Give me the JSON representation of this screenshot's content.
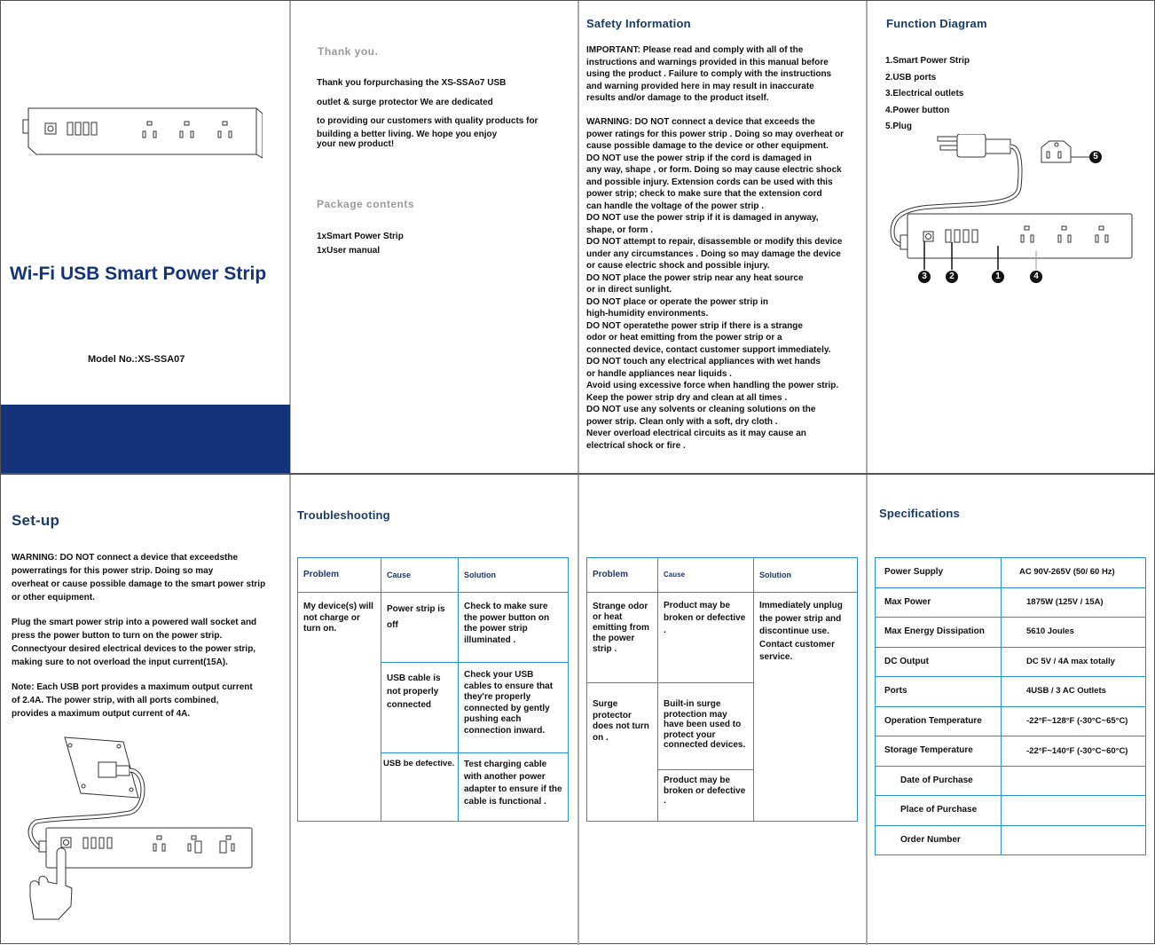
{
  "cover": {
    "title": "Wi-Fi USB Smart Power Strip",
    "model": "Model No.:XS-SSA07",
    "brand_color": "#15337a"
  },
  "thanks": {
    "heading": "Thank you.",
    "lines": [
      "Thank you forpurchasing  the XS-SSAo7 USB",
      "outlet & surge protector We are dedicated",
      "to providing our customers with quality products for",
      "building a better living. We hope you enjoy",
      "your new product!"
    ]
  },
  "package": {
    "heading": "Package contents",
    "items": [
      "1xSmart Power Strip",
      "1xUser manual"
    ]
  },
  "safety": {
    "heading": "Safety Information",
    "important": [
      "IMPORTANT: Please read and  comply with all of  the",
      "instructions and warnings provided  in this manual before",
      "using the product . Failure  to comply with the  instructions",
      "and warning provided here  in may result in  inaccurate",
      "results and/or damage to  the product itself."
    ],
    "warnings": [
      "WARNING: DO NOT  connect a device that  exceeds the",
      "power ratings for this  power strip . Doing so  may overheat or",
      "cause possible damage to  the device or other equipment.",
      "DO NOT use the power strip  if the cord is damaged in",
      "any way, shape , or form. Doing so may cause electric shock",
      "and possible injury.  Extension  cords can be used  with this",
      "power strip; check to make  sure that the extension  cord",
      "can handle the voltage of the power strip .",
      "DO NOT use the power strip  if it is damaged in anyway,",
      "shape, or form .",
      "DO NOT attempt to repair, disassemble or modify this  device",
      "under any circumstances . Doing  so may damage the  device",
      "or cause electric shock and possible injury.",
      "DO NOT place the power strip near any heat source",
      "or in direct sunlight.",
      "DO NOT place or operate the  power strip in",
      "high-humidity environments.",
      "DO NOT operatethe power strip  if there is a strange",
      "odor or heat emitting  from the power strip  or a",
      "connected device, contact customer  support immediately.",
      "DO NOT  touch any electrical appliances  with wet hands",
      "or handle appliances near  liquids .",
      "Avoid using excessive force  when handling the  power strip.",
      "Keep the power strip  dry and clean at  all times .",
      "DO NOT use any solvents or  cleaning solutions on the",
      "power strip. Clean only with a soft, dry cloth .",
      "Never overload electrical circuits as it may cause  an",
      "electrical shock or fire ."
    ]
  },
  "function": {
    "heading": "Function Diagram",
    "items": [
      "1.Smart Power Strip",
      "2.USB ports",
      "3.Electrical outlets",
      "4.Power button",
      "5.Plug"
    ],
    "callouts": [
      "1",
      "2",
      "3",
      "4",
      "5"
    ]
  },
  "setup": {
    "heading": "Set-up",
    "warning": [
      "WARNING:  DO NOT connect a device that exceedsthe",
      "powerratings for this power strip. Doing so may",
      "overheat or cause possible  damage to the smart  power strip",
      "or other equipment."
    ],
    "plug": [
      "Plug the smart power  strip into a powered  wall socket and",
      "press the power button to turn on the  power strip.",
      "Connectyour desired  electrical  devices to the power  strip,",
      "making sure to not overload the input current(15A)."
    ],
    "note": [
      "Note: Each USB port provides a maximum output current",
      "of 2.4A. The power strip, with all ports  combined,",
      "provides a maximum output current of 4A."
    ]
  },
  "troubleshooting": {
    "heading": "Troubleshooting",
    "headers": [
      "Problem",
      "Cause",
      "Solution"
    ],
    "table1": {
      "problem": "My device(s) will not charge or turn on.",
      "rows": [
        {
          "cause": "Power strip is off",
          "solution": "Check to make sure the power button on the power strip illuminated ."
        },
        {
          "cause": "USB cable is not properly connected",
          "solution": "Check your USB cables to ensure that they're properly connected by gently pushing each connection inward."
        },
        {
          "cause": "USB be defective.",
          "solution": "Test charging  cable with another power adapter to ensure if the cable is functional ."
        }
      ]
    },
    "table2": {
      "row1": {
        "problem": "Strange odor or heat emitting from the power strip .",
        "cause": "Product may be broken or defective .",
        "solution": "Immediately unplug the power strip and discontinue use. Contact customer service."
      },
      "row2": {
        "problem": "Surge protector does not turn on .",
        "causes": [
          "Built-in surge protection may have been used to protect your connected devices.",
          "Product may be broken or defective ."
        ]
      }
    }
  },
  "specs": {
    "heading": "Specifications",
    "rows": [
      {
        "label": "Power Supply",
        "value": "AC 90V-265V (50/ 60 Hz)"
      },
      {
        "label": "Max Power",
        "value": "1875W (125V / 15A)"
      },
      {
        "label": "Max Energy Dissipation",
        "value": "5610 Joules"
      },
      {
        "label": "DC Output",
        "value": "DC 5V / 4A max totally"
      },
      {
        "label": "Ports",
        "value": "4USB / 3 AC Outlets"
      },
      {
        "label": "Operation Temperature",
        "value": "-22°F~128°F (-30°C~65°C)"
      },
      {
        "label": "Storage Temperature",
        "value": "-22°F~140°F (-30°C~60°C)"
      },
      {
        "label": "Date of Purchase",
        "value": ""
      },
      {
        "label": "Place of Purchase",
        "value": ""
      },
      {
        "label": "Order Number",
        "value": ""
      }
    ]
  }
}
